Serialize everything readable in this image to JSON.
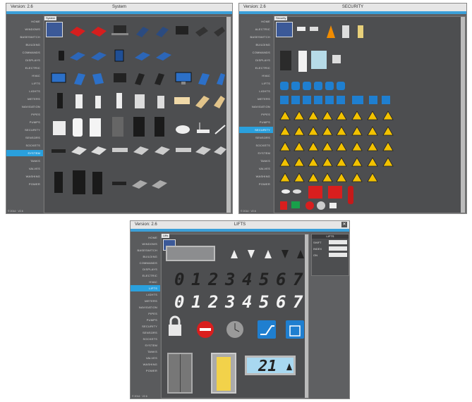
{
  "windows": [
    {
      "id": "system",
      "version": "Version: 2.6",
      "title": "System",
      "tab": "System",
      "footer": "© 2014 · V2.6",
      "sidebar": [
        "HOME",
        "WINDOWS",
        "BASESWITCH",
        "BUILDING",
        "COMMANDS",
        "DISPLAYS",
        "ELECTRIC",
        "HVAC",
        "LIFTS",
        "LIGHTS",
        "METERS",
        "NAVIGATION",
        "PIPES",
        "PUMPS",
        "SECURITY",
        "SENSORS",
        "SOCKETS",
        "SYSTEM",
        "TANKS",
        "VALVES",
        "WASHING",
        "POWER"
      ],
      "active": "SYSTEM"
    },
    {
      "id": "security",
      "version": "Version: 2.6",
      "title": "SECURITY",
      "tab": "Security",
      "footer": "© 2014 · V2.6",
      "sidebar": [
        "HOME",
        "ALECTRIC",
        "BASESWITCH",
        "BUILDING",
        "COMMANDS",
        "DISPLAYS",
        "ELECTRIC",
        "HVAC",
        "LIFTS",
        "LIGHTS",
        "METERS",
        "NAVIGATION",
        "PIPES",
        "PUMPS",
        "SECURITY",
        "SENSORS",
        "SOCKETS",
        "SYSTEM",
        "TANKS",
        "VALVES",
        "WASHING",
        "POWER"
      ],
      "active": "SECURITY"
    },
    {
      "id": "lifts",
      "version": "Version: 2.6",
      "title": "LIFTS",
      "tab": "Lifts",
      "footer": "© 2014 · V2.6",
      "sidebar": [
        "HOME",
        "WINDOWS",
        "BASESWITCH",
        "BUILDING",
        "COMMANDS",
        "DISPLAYS",
        "ELECTRIC",
        "HVAC",
        "LIFTS",
        "LIGHTS",
        "METERS",
        "NAVIGATION",
        "PIPES",
        "PUMPS",
        "SECURITY",
        "SENSORS",
        "SOCKETS",
        "SYSTEM",
        "TANKS",
        "VALVES",
        "WASHING",
        "POWER"
      ],
      "active": "LIFTS",
      "lcd_digits": [
        "0",
        "1",
        "2",
        "3",
        "4",
        "5",
        "6",
        "7"
      ],
      "floor_display": "21",
      "props_title": "LIFTS",
      "props_rows": [
        "SHIFT",
        "INDEX",
        "ON"
      ]
    }
  ],
  "colors": {
    "accent": "#2aa0dd",
    "window_bg": "#5f6062",
    "warning": "#f2c200",
    "info_blue": "#1f7fd0",
    "alarm_red": "#d91e1e"
  }
}
